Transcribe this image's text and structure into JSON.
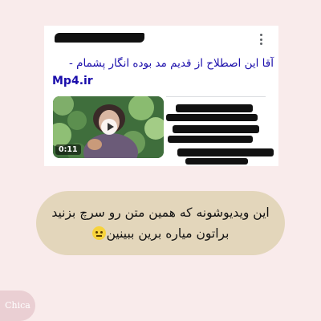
{
  "search_result": {
    "title": "آقا این اصطلاح از قدیم مد بوده انگار پشمام -",
    "site": "Mp4.ir",
    "video": {
      "duration": "0:11",
      "play_icon": "play-icon"
    },
    "menu_icon": "more-vert-icon"
  },
  "caption": {
    "line1": "این ویدیوشونه که همین متن رو سرچ بزنید",
    "line2": "براتون میاره برین ببینین",
    "emoji": "neutral-face-emoji"
  },
  "watermark": {
    "text": "Chica"
  },
  "colors": {
    "background": "#f9ebeb",
    "card": "#ffffff",
    "link": "#1a0dab",
    "caption_bubble": "#e3d6bb",
    "redaction": "#111111",
    "watermark": "#eacfd3"
  }
}
